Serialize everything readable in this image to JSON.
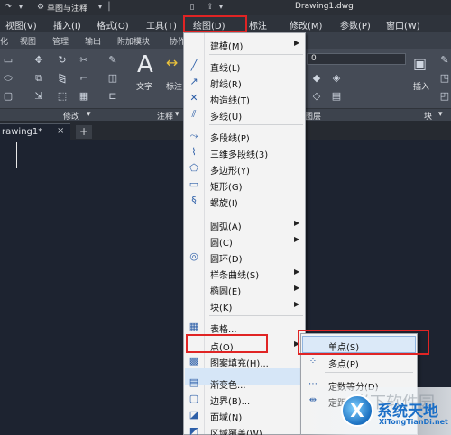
{
  "titlebar": {
    "workspace": "草图与注释",
    "filename": "Drawing1.dwg"
  },
  "menubar": {
    "items": [
      "视图(V)",
      "插入(I)",
      "格式(O)",
      "工具(T)",
      "绘图(D)",
      "标注",
      "修改(M)",
      "参数(P)",
      "窗口(W)"
    ]
  },
  "ribbon_tabs": [
    "化",
    "视图",
    "管理",
    "输出",
    "附加模块",
    "协作"
  ],
  "ribbon": {
    "text_label": "文字",
    "dim_label": "标注",
    "layer_value": "0",
    "insert_label": "插入",
    "footer": {
      "modify": "修改",
      "annotate": "注释",
      "layer": "图层",
      "block": "块"
    }
  },
  "doc_tabs": {
    "active": "rawing1*",
    "close": "×",
    "new": "+"
  },
  "draw_menu": {
    "items": [
      {
        "label": "建模(M)",
        "icon": "",
        "submenu": true
      },
      {
        "label": "直线(L)",
        "icon": "line-icon",
        "submenu": false
      },
      {
        "label": "射线(R)",
        "icon": "ray-icon",
        "submenu": false
      },
      {
        "label": "构造线(T)",
        "icon": "xline-icon",
        "submenu": false
      },
      {
        "label": "多线(U)",
        "icon": "mline-icon",
        "submenu": false
      },
      {
        "label": "多段线(P)",
        "icon": "pline-icon",
        "submenu": false
      },
      {
        "label": "三维多段线(3)",
        "icon": "3dpoly-icon",
        "submenu": false
      },
      {
        "label": "多边形(Y)",
        "icon": "polygon-icon",
        "submenu": false
      },
      {
        "label": "矩形(G)",
        "icon": "rectangle-icon",
        "submenu": false
      },
      {
        "label": "螺旋(I)",
        "icon": "helix-icon",
        "submenu": false
      },
      {
        "label": "圆弧(A)",
        "icon": "",
        "submenu": true
      },
      {
        "label": "圆(C)",
        "icon": "",
        "submenu": true
      },
      {
        "label": "圆环(D)",
        "icon": "donut-icon",
        "submenu": false
      },
      {
        "label": "样条曲线(S)",
        "icon": "",
        "submenu": true
      },
      {
        "label": "椭圆(E)",
        "icon": "",
        "submenu": true
      },
      {
        "label": "块(K)",
        "icon": "",
        "submenu": true
      },
      {
        "label": "表格...",
        "icon": "table-icon",
        "submenu": false
      },
      {
        "label": "点(O)",
        "icon": "",
        "submenu": true
      },
      {
        "label": "图案填充(H)...",
        "icon": "hatch-icon",
        "submenu": false
      },
      {
        "label": "渐变色...",
        "icon": "gradient-icon",
        "submenu": false
      },
      {
        "label": "边界(B)...",
        "icon": "boundary-icon",
        "submenu": false
      },
      {
        "label": "面域(N)",
        "icon": "region-icon",
        "submenu": false
      },
      {
        "label": "区域覆盖(W)",
        "icon": "wipeout-icon",
        "submenu": false
      }
    ]
  },
  "point_submenu": {
    "items": [
      {
        "label": "单点(S)",
        "icon": ""
      },
      {
        "label": "多点(P)",
        "icon": "multipoint-icon"
      },
      {
        "label": "定数等分(D)",
        "icon": "divide-icon"
      },
      {
        "label": "定距",
        "icon": "measure-icon"
      }
    ]
  },
  "watermark": {
    "ghost": "光下软件园",
    "logo_letter": "X",
    "title": "系统天地",
    "url": "XiTongTianDi.net"
  },
  "colors": {
    "highlight_box": "#e02424",
    "menu_bg": "#f3f3f3",
    "canvas_bg": "#1d2330",
    "watermark_blue": "#1b6fc7"
  }
}
